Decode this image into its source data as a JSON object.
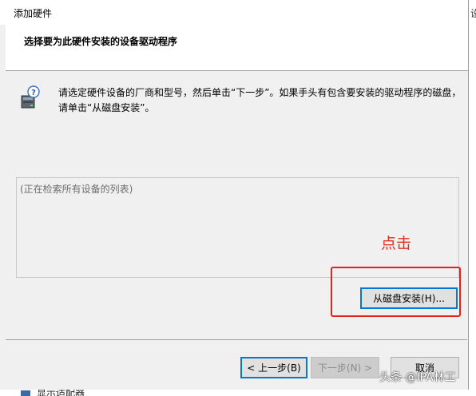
{
  "window": {
    "title": "添加硬件"
  },
  "background": {
    "right_fragment": "设"
  },
  "header": {
    "heading": "选择要为此硬件安装的设备驱动程序"
  },
  "instructions": {
    "line1": "请选定硬件设备的厂商和型号，然后单击“下一步”。如果手头有包含要安装的驱动程序的磁盘，",
    "line2": "请单击“从磁盘安装”。"
  },
  "device_list": {
    "placeholder": "(正在检索所有设备的列表)"
  },
  "annotation": {
    "text": "点击",
    "color": "#e0301e"
  },
  "buttons": {
    "have_disk": "从磁盘安装(H)...",
    "back": "< 上一步(B)",
    "next": "下一步(N) >",
    "cancel": "取消"
  },
  "taskbar": {
    "item_label": "显示适配器"
  },
  "watermark": {
    "text": "头条 @IPA林工"
  },
  "icons": {
    "hardware": "hardware-help-icon"
  }
}
